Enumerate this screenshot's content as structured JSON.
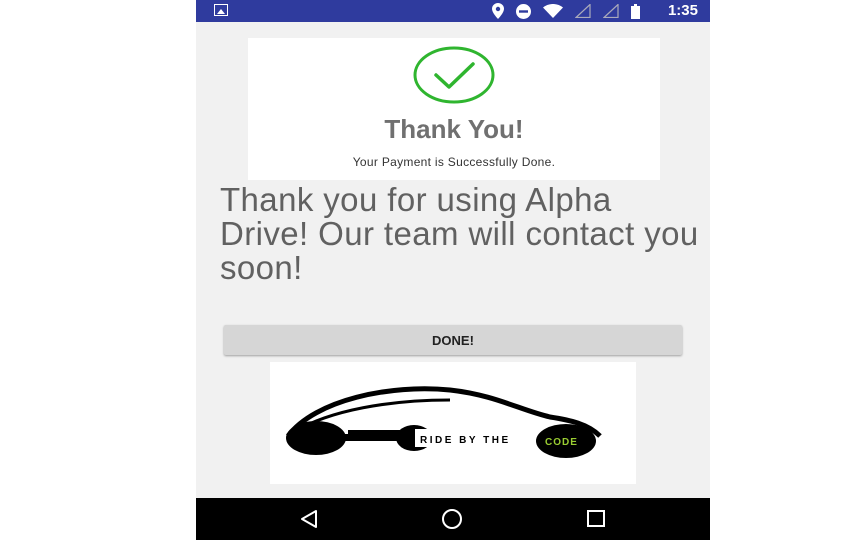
{
  "status_bar": {
    "time": "1:35",
    "icons": [
      "image-icon",
      "location-icon",
      "do-not-disturb-icon",
      "wifi-icon",
      "signal-icon",
      "signal-icon",
      "battery-icon"
    ]
  },
  "payment_card": {
    "title": "Thank You!",
    "subtitle": "Your Payment is Successfully Done."
  },
  "message": "Thank you for using Alpha Drive! Our team will contact you soon!",
  "done_button": {
    "label": "DONE!"
  },
  "logo": {
    "text_ride": "RIDE BY THE",
    "text_code": "CODE"
  },
  "nav_bar": {
    "items": [
      "back-icon",
      "home-icon",
      "recents-icon"
    ]
  },
  "colors": {
    "status_bar": "#2f3b9e",
    "check": "#2fb52f",
    "button": "#d6d6d6",
    "logo_green": "#9acd32"
  }
}
